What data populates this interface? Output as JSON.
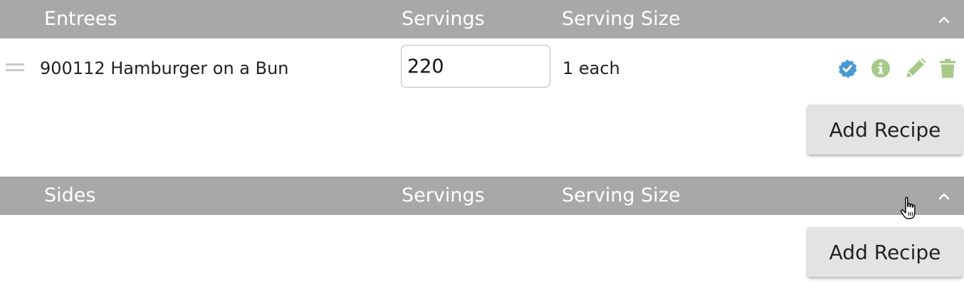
{
  "entrees": {
    "header": {
      "title": "Entrees",
      "servings_label": "Servings",
      "serving_size_label": "Serving Size"
    },
    "recipes": [
      {
        "name": "900112 Hamburger on a Bun",
        "servings": "220",
        "serving_size": "1 each"
      }
    ],
    "add_button_label": "Add Recipe"
  },
  "sides": {
    "header": {
      "title": "Sides",
      "servings_label": "Servings",
      "serving_size_label": "Serving Size"
    },
    "add_button_label": "Add Recipe"
  },
  "icons": {
    "verified": "verified-badge-icon",
    "info": "info-icon",
    "edit": "pencil-icon",
    "delete": "trash-icon",
    "collapse": "chevron-up-icon",
    "drag": "drag-handle-icon",
    "cursor": "hand-pointer-cursor"
  },
  "colors": {
    "header_bg": "#a8a8a8",
    "header_text": "#ffffff",
    "verified_blue": "#4a98d2",
    "action_green": "#a7c98a",
    "button_bg": "#e3e3e3"
  }
}
